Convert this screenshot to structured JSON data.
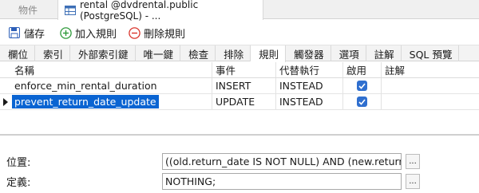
{
  "doc_tabs": {
    "objects_label": "物件",
    "active_label": "rental @dvdrental.public (PostgreSQL) - ..."
  },
  "toolbar": {
    "save_label": "儲存",
    "add_rule_label": "加入規則",
    "delete_rule_label": "刪除規則",
    "accent_add": "#2e9a3a",
    "accent_delete": "#d9342b",
    "accent_save": "#2d5fb8"
  },
  "sub_tabs": [
    {
      "label": "欄位"
    },
    {
      "label": "索引"
    },
    {
      "label": "外部索引鍵"
    },
    {
      "label": "唯一鍵"
    },
    {
      "label": "檢查"
    },
    {
      "label": "排除"
    },
    {
      "label": "規則"
    },
    {
      "label": "觸發器"
    },
    {
      "label": "選項"
    },
    {
      "label": "註解"
    },
    {
      "label": "SQL 預覽"
    }
  ],
  "grid": {
    "columns": {
      "name": "名稱",
      "event": "事件",
      "instead": "代替執行",
      "enabled": "啟用",
      "comment": "註解"
    },
    "rows": [
      {
        "name": "enforce_min_rental_duration",
        "event": "INSERT",
        "instead": "INSTEAD",
        "enabled": true,
        "comment": ""
      },
      {
        "name": "prevent_return_date_update",
        "event": "UPDATE",
        "instead": "INSTEAD",
        "enabled": true,
        "comment": ""
      }
    ],
    "selected_row": 1
  },
  "details": {
    "where_label": "位置:",
    "where_value": "((old.return_date IS NOT NULL) AND (new.return_date IS",
    "definition_label": "定義:",
    "definition_value": "NOTHING;",
    "ellipsis_label": "..."
  }
}
